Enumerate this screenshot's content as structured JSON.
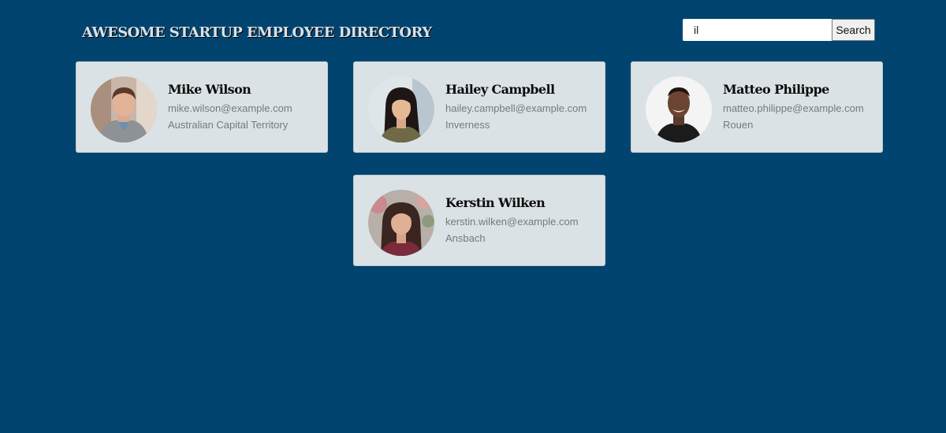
{
  "header": {
    "title": "AWESOME STARTUP EMPLOYEE DIRECTORY"
  },
  "search": {
    "value": "il",
    "button_label": "Search"
  },
  "colors": {
    "background": "#014470",
    "card_background": "#dbe2e5",
    "title_text": "#d8e1e8",
    "secondary_text": "#77797b"
  },
  "employees": [
    {
      "name": "Mike Wilson",
      "email": "mike.wilson@example.com",
      "location": "Australian Capital Territory",
      "avatar": "man-photo"
    },
    {
      "name": "Hailey Campbell",
      "email": "hailey.campbell@example.com",
      "location": "Inverness",
      "avatar": "woman-photo"
    },
    {
      "name": "Matteo Philippe",
      "email": "matteo.philippe@example.com",
      "location": "Rouen",
      "avatar": "man-photo"
    },
    {
      "name": "Kerstin Wilken",
      "email": "kerstin.wilken@example.com",
      "location": "Ansbach",
      "avatar": "woman-photo"
    }
  ]
}
